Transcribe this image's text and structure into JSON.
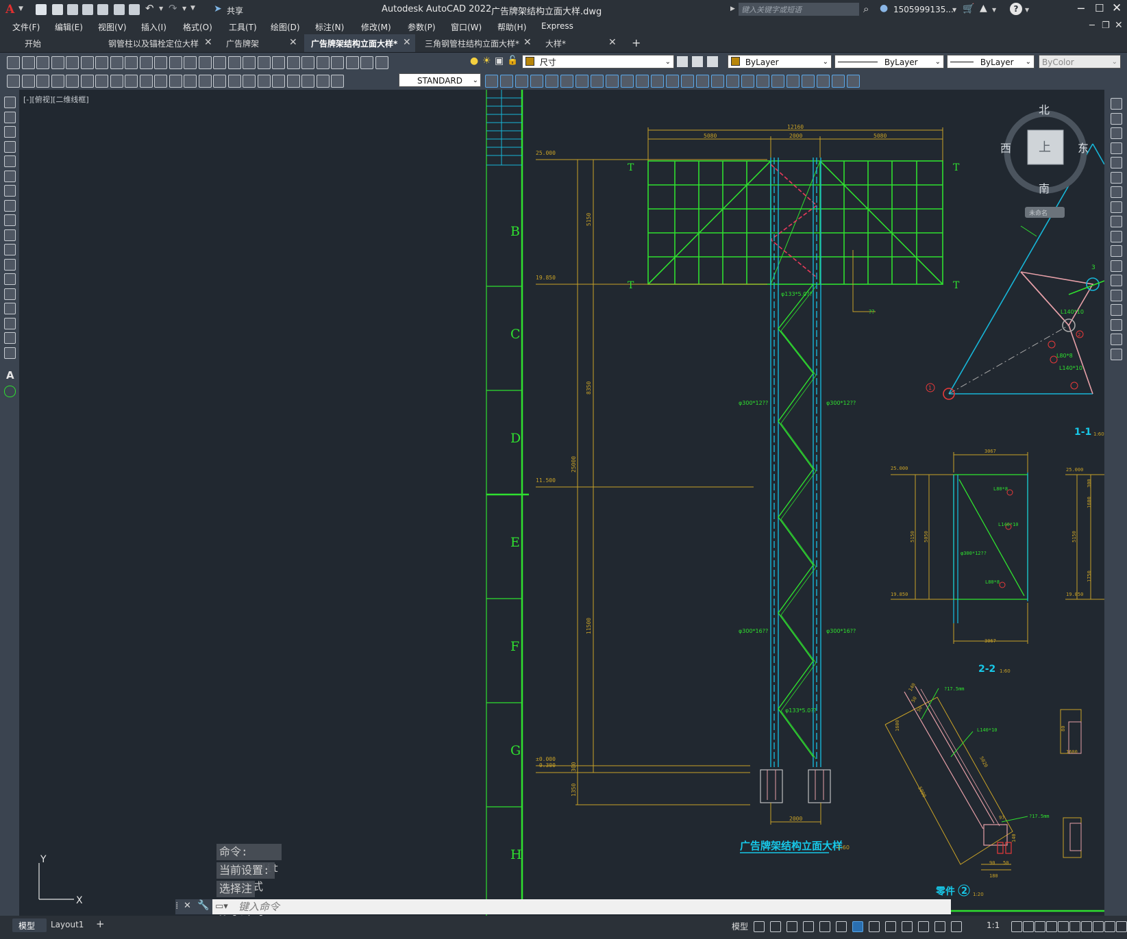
{
  "app": {
    "logo": "A",
    "window_title": "Autodesk AutoCAD 2022",
    "file_name": "广告牌架结构立面大样.dwg",
    "search_placeholder": "键入关键字或短语",
    "user": "1505999135...",
    "share_label": "共享"
  },
  "menu": [
    "文件(F)",
    "编辑(E)",
    "视图(V)",
    "插入(I)",
    "格式(O)",
    "工具(T)",
    "绘图(D)",
    "标注(N)",
    "修改(M)",
    "参数(P)",
    "窗口(W)",
    "帮助(H)",
    "Express"
  ],
  "tabs": [
    {
      "label": "开始"
    },
    {
      "label": "钢管柱以及锚栓定位大样"
    },
    {
      "label": "广告牌架"
    },
    {
      "label": "广告牌架结构立面大样*",
      "active": true
    },
    {
      "label": "三角钢管柱结构立面大样*"
    },
    {
      "label": "大样*"
    }
  ],
  "toolbar": {
    "layer_name": "尺寸",
    "color": "ByLayer",
    "linetype": "ByLayer",
    "lineweight": "ByLayer",
    "plotstyle": "ByColor",
    "text_style": "STANDARD"
  },
  "viewport": {
    "label": "[-][俯视][二维线框]",
    "viewcube": {
      "north": "北",
      "south": "南",
      "west": "西",
      "east": "东",
      "top": "上",
      "wcs": "未命名"
    }
  },
  "drawing": {
    "grid_letters": [
      "B",
      "C",
      "D",
      "E",
      "F",
      "G",
      "H"
    ],
    "dims": {
      "overall_width": "12160",
      "seg_left": "5080",
      "seg_mid": "2000",
      "seg_right": "5080",
      "elev_top": "25.000",
      "elev_board_bottom": "19.850",
      "elev_mid": "11.500",
      "elev_base": "±0.000",
      "elev_base2": "-0.300",
      "board_height": "5150",
      "h1": "8350",
      "h_total": "25000",
      "h_lower": "11500",
      "h_base": "300",
      "h_found": "1350",
      "base_width": "2000"
    },
    "labels": {
      "pipe_top": "φ133*5.0??",
      "pipe_left": "φ300*12??",
      "pipe_right": "φ300*12??",
      "pipe_low_left": "φ300*16??",
      "pipe_low_right": "φ300*16??",
      "brace_low": "φ133*5.0??",
      "leader": "??",
      "T": "T"
    },
    "title_main": "广告牌架结构立面大样",
    "scale_main": "1:60",
    "section_11": {
      "title": "1-1",
      "scale": "1:60",
      "labels": [
        "L140*10",
        "L80*8",
        "L140*10",
        "3",
        "1",
        "2"
      ]
    },
    "section_22": {
      "title": "2-2",
      "scale": "1:60",
      "width": "3067",
      "elev_top": "25.000",
      "elev_bottom": "19.850",
      "h_a": "5150",
      "h_b": "5050",
      "labels": [
        "L80*8",
        "L140*10",
        "φ300*12??",
        "L80*8"
      ],
      "right_dims": [
        "25.000",
        "19.850",
        "300",
        "5150",
        "1600",
        "1750"
      ]
    },
    "part_2": {
      "title": "零件",
      "number": "2",
      "scale": "1:20",
      "labels": [
        "?17.5mm",
        "L140*10",
        "?17.5mm"
      ],
      "dims": [
        "140",
        "50",
        "50",
        "5020",
        "5000",
        "1600",
        "1600",
        "80",
        "90",
        "50",
        "140",
        "97",
        "180"
      ]
    }
  },
  "command": {
    "history": [
      "命令: _textedit",
      "当前设置: 编辑模式 = Multiple",
      "选择注释对象或 [放弃(U)/模式(M)]: *取消*"
    ],
    "placeholder": "键入命令"
  },
  "ucs": {
    "x": "X",
    "y": "Y"
  },
  "status": {
    "layout_tabs": [
      "模型",
      "Layout1"
    ],
    "model_label": "模型",
    "scale": "1:1"
  },
  "colors": {
    "drawing_bg": "#212830",
    "green": "#2fe02f",
    "cyan": "#17b6d8",
    "yellow": "#c9a227",
    "red": "#ff3333",
    "pink": "#e7a0a8"
  }
}
